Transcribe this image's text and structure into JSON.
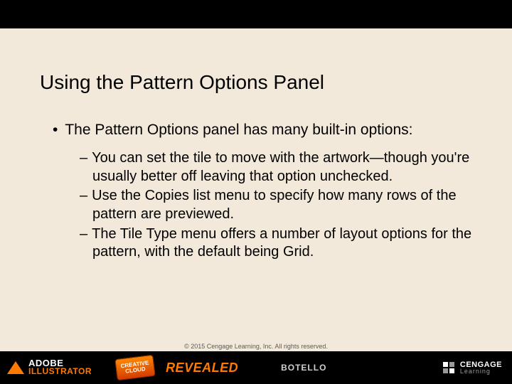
{
  "slide": {
    "title": "Using the Pattern Options Panel",
    "bullet1": "The Pattern Options panel has many built-in options:",
    "sub": [
      "You can set the tile to move with the artwork—though you're usually better off leaving that option unchecked.",
      "Use the Copies list menu to specify how many rows of the pattern are previewed.",
      "The Tile Type menu offers a number of layout options for the pattern, with the default being Grid."
    ]
  },
  "footer": {
    "copyright": "© 2015 Cengage Learning, Inc. All rights reserved.",
    "adobe1": "ADOBE",
    "adobe2": "ILLUSTRATOR",
    "cc_line1": "CREATIVE",
    "cc_line2": "CLOUD",
    "revealed": "REVEALED",
    "author": "BOTELLO",
    "cengage1": "CENGAGE",
    "cengage2": "Learning"
  }
}
